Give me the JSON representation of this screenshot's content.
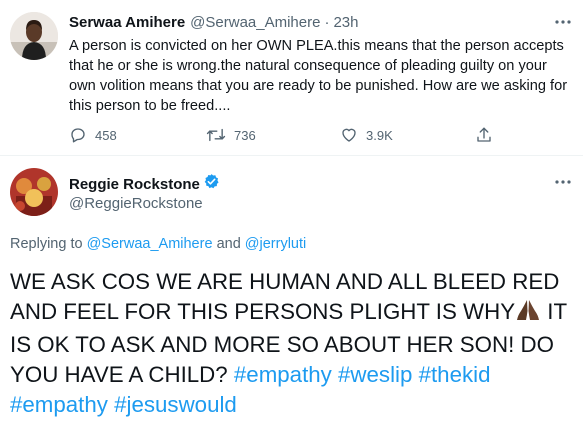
{
  "tweet1": {
    "author_name": "Serwaa Amihere",
    "author_handle": "@Serwaa_Amihere",
    "separator": "·",
    "time": "23h",
    "text": "A person is convicted on her OWN PLEA.this means that the person accepts that he or she is wrong.the natural consequence of pleading guilty on your own volition means that you are ready to be punished. How are we  asking for this  person to be freed....",
    "actions": {
      "reply_count": "458",
      "retweet_count": "736",
      "like_count": "3.9K"
    }
  },
  "tweet2": {
    "author_name": "Reggie Rockstone",
    "author_handle": "@ReggieRockstone",
    "verified": true,
    "replying_to_prefix": "Replying to",
    "replying_to_user1": "@Serwaa_Amihere",
    "replying_to_and": "and",
    "replying_to_user2": "@jerryluti",
    "text_part1": "WE ASK COS WE ARE HUMAN AND ALL BLEED RED AND FEEL FOR THIS PERSONS PLIGHT IS WHY",
    "text_part2": " IT IS OK TO ASK AND MORE SO ABOUT HER SON! DO YOU HAVE A CHILD?",
    "hashtags": [
      "#empathy",
      "#weslip",
      "#thekid",
      "#empathy",
      "#jesuswould"
    ]
  },
  "colors": {
    "accent": "#1d9bf0",
    "muted": "#536471",
    "verified_badge": "#1d9bf0"
  },
  "icons": [
    "more-icon",
    "reply-icon",
    "retweet-icon",
    "like-icon",
    "share-icon",
    "verified-badge-icon",
    "praying-hands-emoji"
  ]
}
